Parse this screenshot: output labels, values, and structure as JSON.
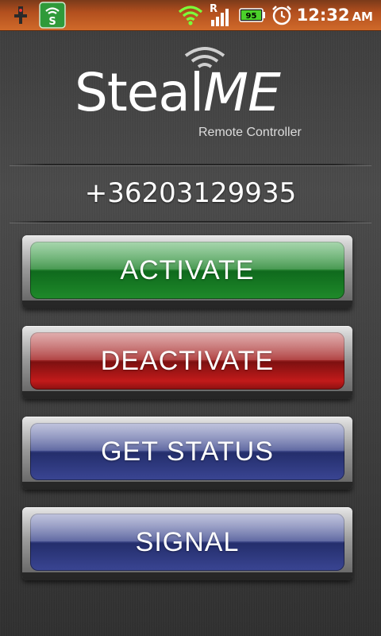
{
  "status_bar": {
    "time": "12:32",
    "ampm": "AM",
    "battery_level": "95",
    "roaming_indicator": "R",
    "icons": [
      "usb-debug-icon",
      "stealme-notification-icon",
      "wifi-icon",
      "signal-icon",
      "battery-icon",
      "alarm-icon"
    ]
  },
  "logo": {
    "name_part1": "Steal",
    "name_part2": "ME",
    "subtitle": "Remote Controller"
  },
  "phone_number": "+36203129935",
  "buttons": {
    "activate": "ACTIVATE",
    "deactivate": "DEACTIVATE",
    "get_status": "GET STATUS",
    "signal": "SIGNAL"
  },
  "colors": {
    "status_bar": "#c05a22",
    "activate": "#2f8b3a",
    "deactivate": "#a72c2c",
    "get_status": "#3a4593",
    "signal": "#3a4593"
  }
}
